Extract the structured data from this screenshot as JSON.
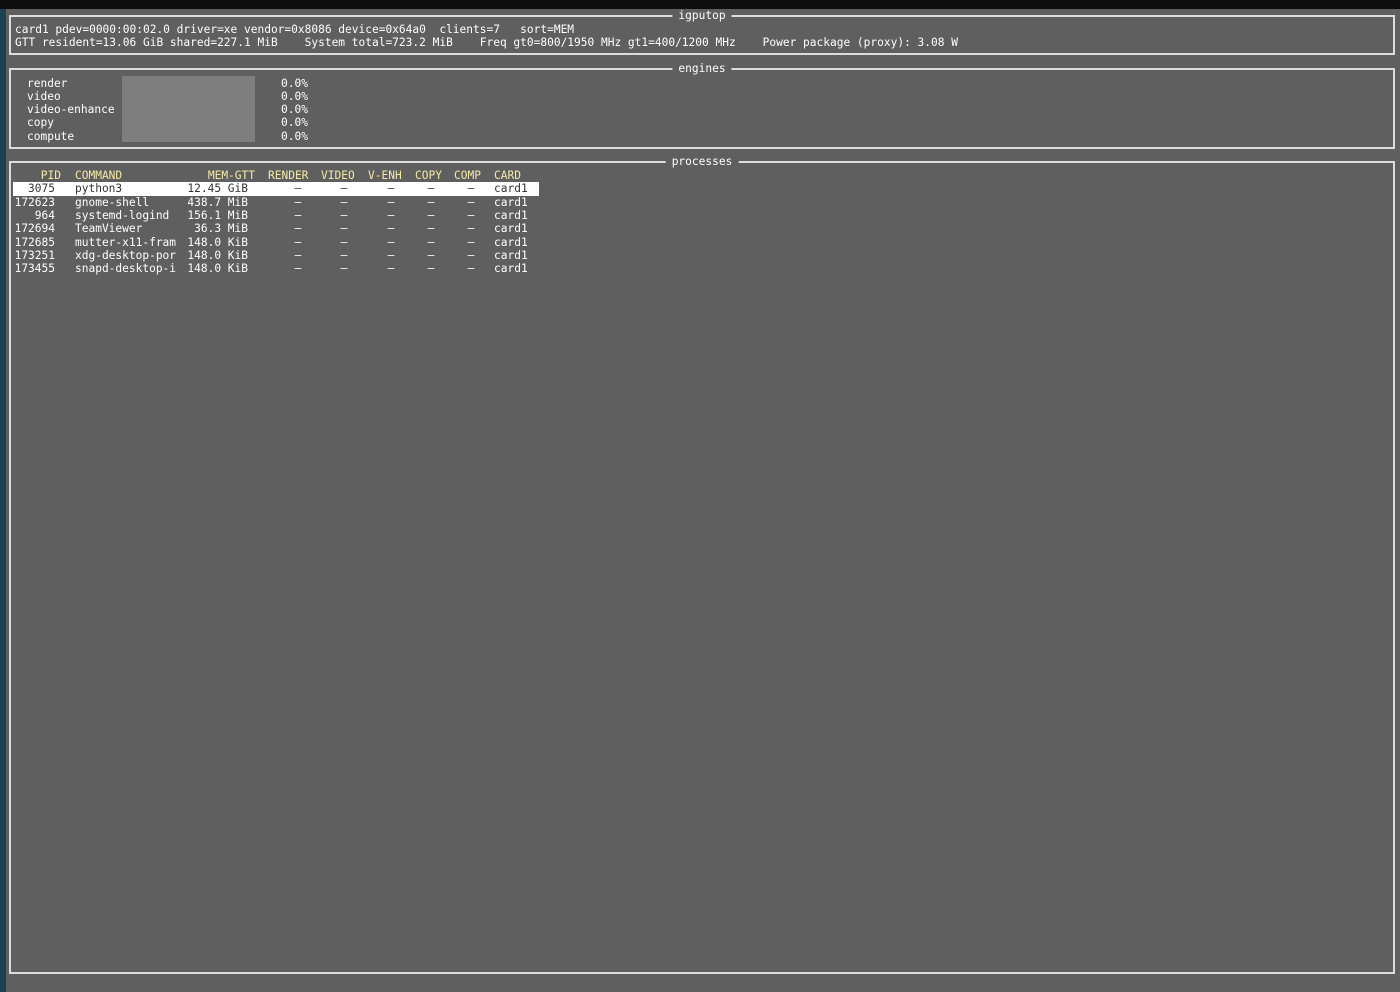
{
  "app": {
    "title": "igputop",
    "header_line1": "card1 pdev=0000:00:02.0 driver=xe vendor=0x8086 device=0x64a0  clients=7   sort=MEM",
    "header_line2": "GTT resident=13.06 GiB shared=227.1 MiB    System total=723.2 MiB    Freq gt0=800/1950 MHz gt1=400/1200 MHz    Power package (proxy): 3.08 W"
  },
  "engines": {
    "title": "engines",
    "items": [
      {
        "name": "render",
        "percent": "0.0%"
      },
      {
        "name": "video",
        "percent": "0.0%"
      },
      {
        "name": "video-enhance",
        "percent": "0.0%"
      },
      {
        "name": "copy",
        "percent": "0.0%"
      },
      {
        "name": "compute",
        "percent": "0.0%"
      }
    ]
  },
  "processes": {
    "title": "processes",
    "columns": {
      "pid": "PID",
      "command": "COMMAND",
      "mem": "MEM-GTT",
      "render": "RENDER",
      "video": "VIDEO",
      "venh": "V-ENH",
      "copy": "COPY",
      "comp": "COMP",
      "card": "CARD"
    },
    "rows": [
      {
        "pid": "3075",
        "command": "python3",
        "mem": "12.45 GiB",
        "render": "—",
        "video": "—",
        "venh": "—",
        "copy": "—",
        "comp": "—",
        "card": "card1"
      },
      {
        "pid": "172623",
        "command": "gnome-shell",
        "mem": "438.7 MiB",
        "render": "—",
        "video": "—",
        "venh": "—",
        "copy": "—",
        "comp": "—",
        "card": "card1"
      },
      {
        "pid": "964",
        "command": "systemd-logind",
        "mem": "156.1 MiB",
        "render": "—",
        "video": "—",
        "venh": "—",
        "copy": "—",
        "comp": "—",
        "card": "card1"
      },
      {
        "pid": "172694",
        "command": "TeamViewer",
        "mem": "36.3 MiB",
        "render": "—",
        "video": "—",
        "venh": "—",
        "copy": "—",
        "comp": "—",
        "card": "card1"
      },
      {
        "pid": "172685",
        "command": "mutter-x11-fram",
        "mem": "148.0 KiB",
        "render": "—",
        "video": "—",
        "venh": "—",
        "copy": "—",
        "comp": "—",
        "card": "card1"
      },
      {
        "pid": "173251",
        "command": "xdg-desktop-por",
        "mem": "148.0 KiB",
        "render": "—",
        "video": "—",
        "venh": "—",
        "copy": "—",
        "comp": "—",
        "card": "card1"
      },
      {
        "pid": "173455",
        "command": "snapd-desktop-i",
        "mem": "148.0 KiB",
        "render": "—",
        "video": "—",
        "venh": "—",
        "copy": "—",
        "comp": "—",
        "card": "card1"
      }
    ]
  },
  "colors": {
    "background": "#5f5f5f",
    "border": "#dcdcdc",
    "header_text": "#f4e9a6",
    "selection": "#ffffff",
    "engine_bar": "#7e7e7e"
  }
}
